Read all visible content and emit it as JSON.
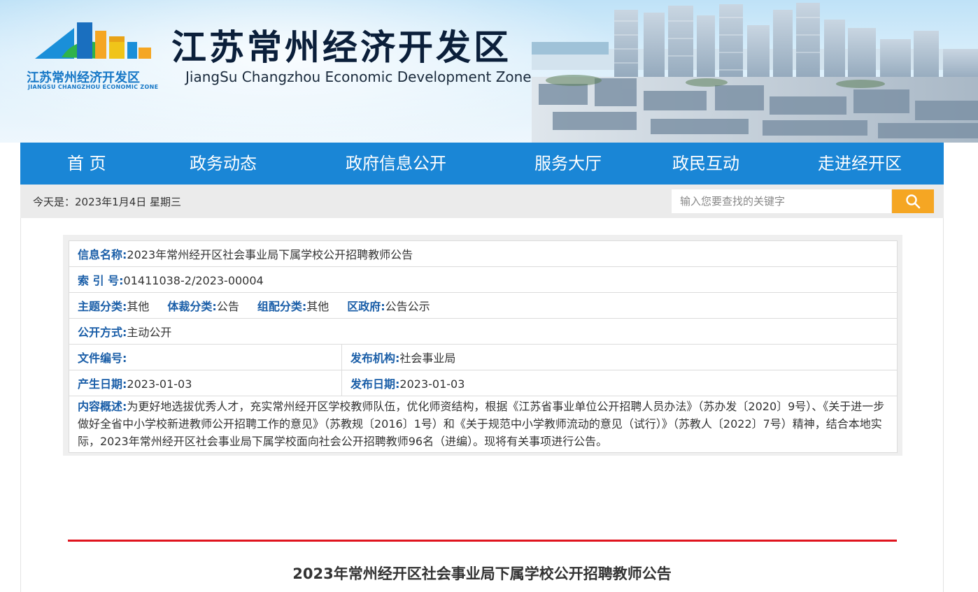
{
  "header": {
    "logo_text_cn": "江苏常州经济开发区",
    "logo_text_en": "JIANGSU CHANGZHOU ECONOMIC ZONE",
    "title_cn": "江苏常州经济开发区",
    "title_en": "JiangSu Changzhou Economic Development Zone"
  },
  "nav": {
    "items": [
      {
        "label": "首 页"
      },
      {
        "label": "政务动态"
      },
      {
        "label": "政府信息公开"
      },
      {
        "label": "服务大厅"
      },
      {
        "label": "政民互动"
      },
      {
        "label": "走进经开区"
      }
    ]
  },
  "topbar": {
    "today_text": "今天是：2023年1月4日 星期三",
    "search_placeholder": "输入您要查找的关键字",
    "search_icon": "search-icon"
  },
  "info": {
    "name_label": "信息名称:",
    "name_value": "2023年常州经开区社会事业局下属学校公开招聘教师公告",
    "index_label": "索 引 号:",
    "index_value": "01411038-2/2023-00004",
    "topic_label": "主题分类:",
    "topic_value": "其他",
    "genre_label": "体裁分类:",
    "genre_value": "公告",
    "org_label": "组配分类:",
    "org_value": "其他",
    "district_label": "区政府:",
    "district_value": "公告公示",
    "mode_label": "公开方式:",
    "mode_value": "主动公开",
    "docno_label": "文件编号:",
    "docno_value": "",
    "issuer_label": "发布机构:",
    "issuer_value": "社会事业局",
    "created_label": "产生日期:",
    "created_value": "2023-01-03",
    "published_label": "发布日期:",
    "published_value": "2023-01-03",
    "summary_label": "内容概述:",
    "summary_value": "为更好地选拔优秀人才，充实常州经开区学校教师队伍，优化师资结构，根据《江苏省事业单位公开招聘人员办法》（苏办发〔2020〕9号）、《关于进一步做好全省中小学校新进教师公开招聘工作的意见》（苏教规〔2016〕1号）和《关于规范中小学教师流动的意见（试行）》（苏教人〔2022〕7号）精神，结合本地实际，2023年常州经开区社会事业局下属学校面向社会公开招聘教师96名（进编）。现将有关事项进行公告。"
  },
  "article": {
    "title": "2023年常州经开区社会事业局下属学校公开招聘教师公告"
  },
  "colors": {
    "nav_bg": "#1a86d6",
    "label_blue": "#1a5ea8",
    "search_btn": "#f5a623",
    "accent_red": "#e0141e"
  }
}
